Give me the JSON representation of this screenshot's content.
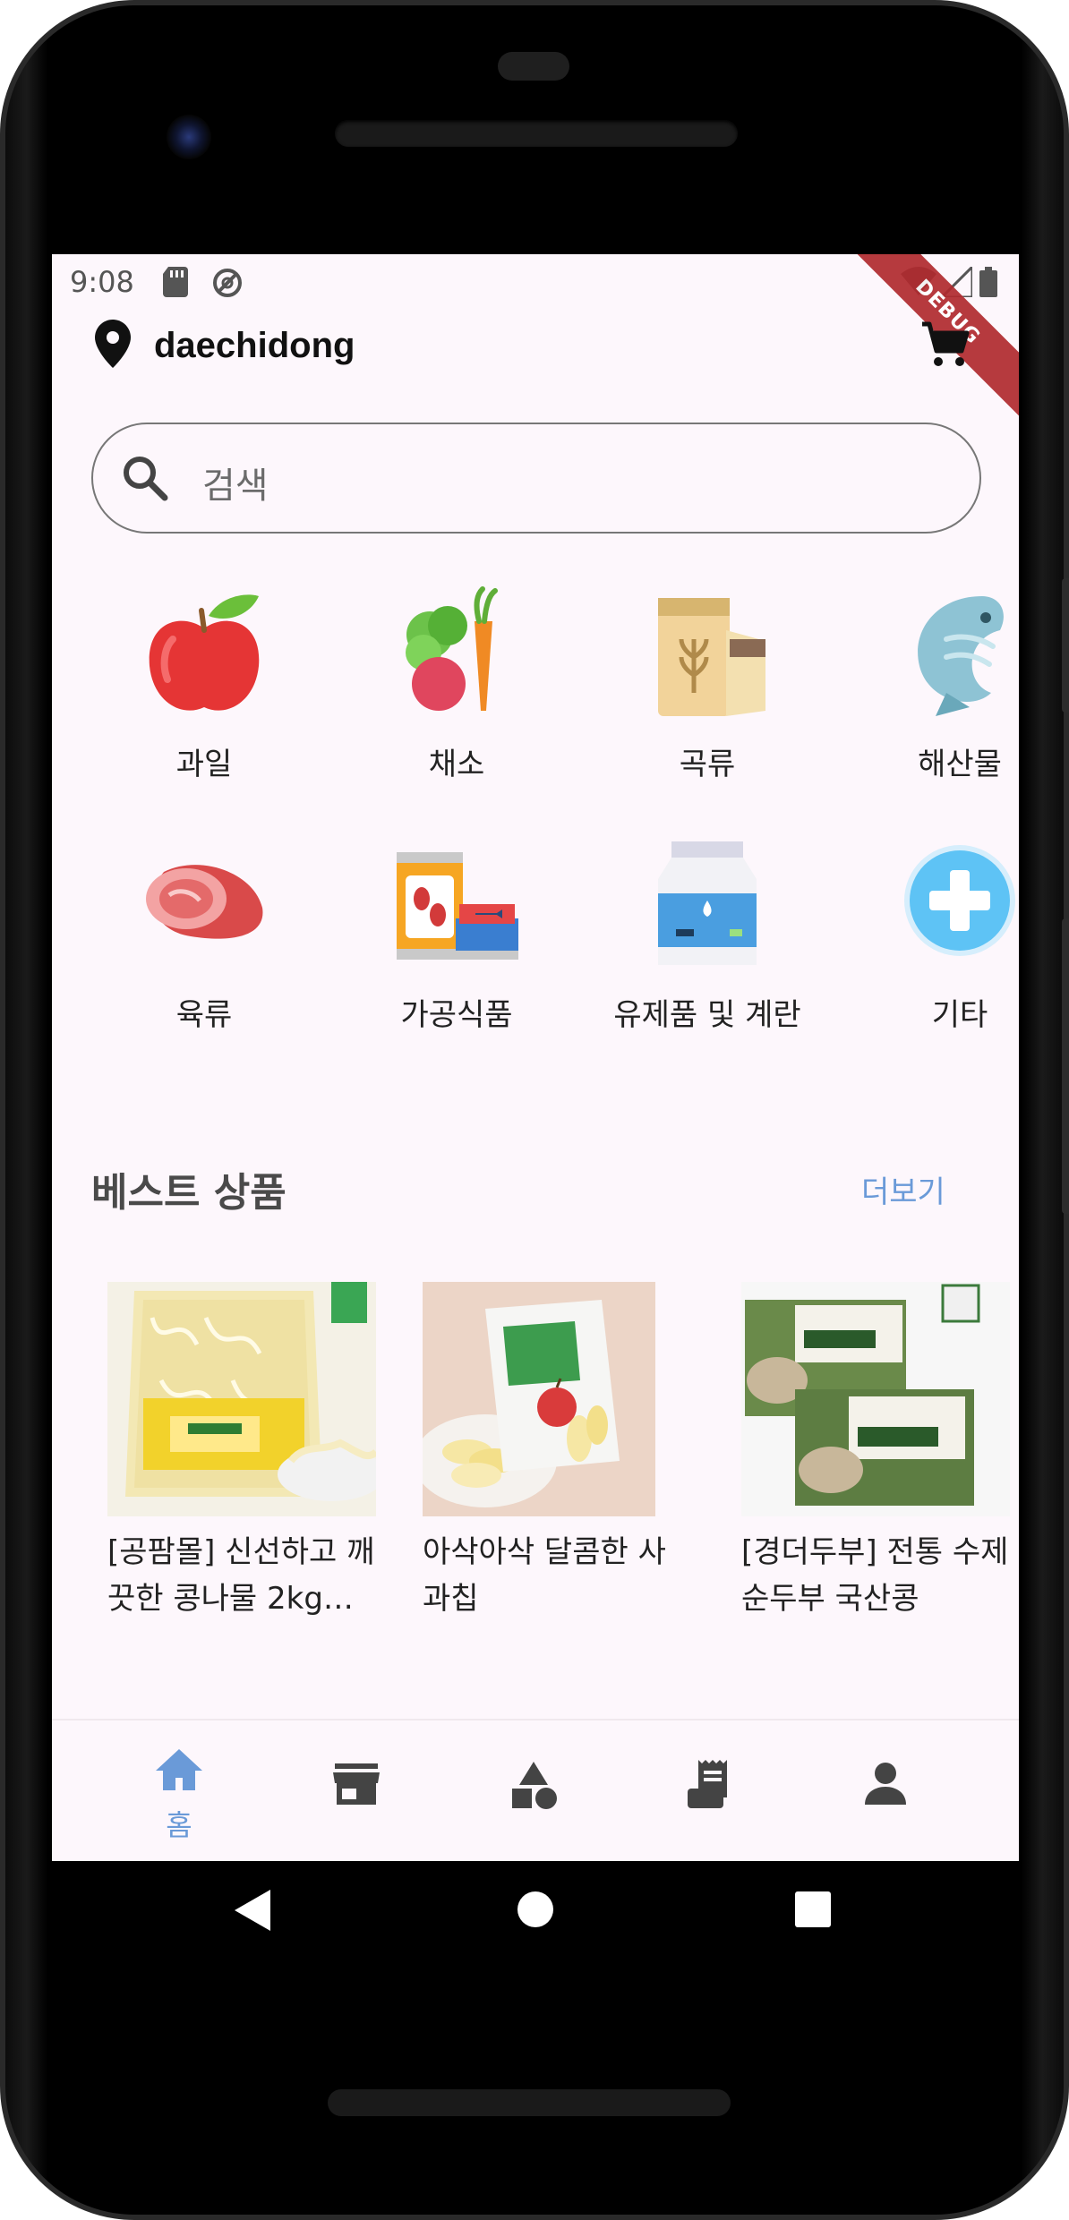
{
  "status_bar": {
    "time": "9:08"
  },
  "debug_banner": "DEBUG",
  "header": {
    "location": "daechidong"
  },
  "search": {
    "placeholder": "검색"
  },
  "categories": [
    {
      "label": "과일",
      "icon": "apple-icon"
    },
    {
      "label": "채소",
      "icon": "vegetable-icon"
    },
    {
      "label": "곡류",
      "icon": "grain-bag-icon"
    },
    {
      "label": "해산물",
      "icon": "fish-icon"
    },
    {
      "label": "육류",
      "icon": "meat-icon"
    },
    {
      "label": "가공식품",
      "icon": "canned-food-icon"
    },
    {
      "label": "유제품 및 계란",
      "icon": "milk-carton-icon"
    },
    {
      "label": "기타",
      "icon": "plus-icon"
    }
  ],
  "best": {
    "title": "베스트 상품",
    "more_label": "더보기",
    "products": [
      {
        "title": "[공팜몰] 신선하고 깨끗한 콩나물 2kg…",
        "image": "bean-sprouts-bag"
      },
      {
        "title": "아삭아삭 달콤한 사과칩",
        "image": "apple-chips-pack"
      },
      {
        "title": "[경더두부] 전통 수제 순두부 국산콩",
        "image": "tofu-pack"
      }
    ]
  },
  "bottom_nav": {
    "items": [
      {
        "label": "홈",
        "icon": "home-icon",
        "active": true
      },
      {
        "label": "",
        "icon": "store-icon",
        "active": false
      },
      {
        "label": "",
        "icon": "categories-icon",
        "active": false
      },
      {
        "label": "",
        "icon": "receipt-icon",
        "active": false
      },
      {
        "label": "",
        "icon": "person-icon",
        "active": false
      }
    ]
  },
  "colors": {
    "accent": "#6a9ad8",
    "screen_bg": "#fdf7fc",
    "debug": "#b02a2e"
  }
}
